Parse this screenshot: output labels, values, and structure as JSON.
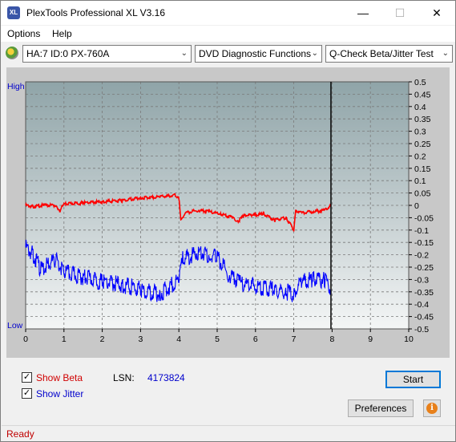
{
  "window": {
    "title": "PlexTools Professional XL V3.16",
    "icon_text": "XL",
    "minimize_glyph": "—",
    "maximize_glyph": "☐",
    "close_glyph": "✕"
  },
  "menu": {
    "options_label": "Options",
    "help_label": "Help"
  },
  "toolbar": {
    "drive": "HA:7 ID:0  PX-760A",
    "function": "DVD Diagnostic Functions",
    "test": "Q-Check Beta/Jitter Test",
    "dropdown_glyph": "⌄"
  },
  "chart_data": {
    "type": "line",
    "left_axis_labels": {
      "top": "High",
      "bottom": "Low"
    },
    "x_ticks": [
      0,
      1,
      2,
      3,
      4,
      5,
      6,
      7,
      8,
      9,
      10
    ],
    "xlim": [
      0,
      10
    ],
    "y_right_ticks": [
      "0.5",
      "0.45",
      "0.4",
      "0.35",
      "0.3",
      "0.25",
      "0.2",
      "0.15",
      "0.1",
      "0.05",
      "0",
      "-0.05",
      "-0.1",
      "-0.15",
      "-0.2",
      "-0.25",
      "-0.3",
      "-0.35",
      "-0.4",
      "-0.45",
      "-0.5"
    ],
    "ylim": [
      -0.5,
      0.5
    ],
    "grid": true,
    "cursor_x": 7.97,
    "series": [
      {
        "color": "#ff0000",
        "x": [
          0,
          0.2,
          0.5,
          0.8,
          0.9,
          0.95,
          1.0,
          1.5,
          2.0,
          2.5,
          3.0,
          3.5,
          3.9,
          4.0,
          4.05,
          4.2,
          4.5,
          4.8,
          5.1,
          5.4,
          5.55,
          5.7,
          5.9,
          6.2,
          6.5,
          6.8,
          7.0,
          7.05,
          7.2,
          7.5,
          7.8,
          7.97
        ],
        "y": [
          0.0,
          -0.005,
          0.0,
          0.0,
          -0.03,
          0.0,
          0.005,
          0.01,
          0.015,
          0.02,
          0.03,
          0.035,
          0.04,
          0.03,
          -0.055,
          -0.03,
          -0.02,
          -0.025,
          -0.035,
          -0.05,
          -0.065,
          -0.04,
          -0.04,
          -0.035,
          -0.06,
          -0.05,
          -0.1,
          -0.02,
          -0.03,
          -0.025,
          -0.02,
          0.0
        ]
      },
      {
        "color": "#0000ff",
        "x": [
          0,
          0.2,
          0.4,
          0.6,
          0.8,
          1.0,
          1.5,
          2.0,
          2.5,
          3.0,
          3.5,
          4.0,
          4.1,
          4.5,
          4.8,
          5.0,
          5.3,
          5.6,
          6.0,
          6.5,
          6.8,
          7.0,
          7.2,
          7.5,
          7.8,
          7.97
        ],
        "y": [
          -0.17,
          -0.2,
          -0.26,
          -0.24,
          -0.22,
          -0.27,
          -0.29,
          -0.31,
          -0.32,
          -0.34,
          -0.36,
          -0.3,
          -0.22,
          -0.19,
          -0.2,
          -0.21,
          -0.28,
          -0.31,
          -0.33,
          -0.34,
          -0.35,
          -0.36,
          -0.31,
          -0.3,
          -0.3,
          -0.34
        ]
      }
    ]
  },
  "options": {
    "show_beta": {
      "label": "Show Beta",
      "checked": true,
      "color": "#d00000"
    },
    "show_jitter": {
      "label": "Show Jitter",
      "checked": true,
      "color": "#0000cc"
    },
    "check_glyph": "✓"
  },
  "lsn": {
    "label": "LSN:",
    "value": "4173824"
  },
  "buttons": {
    "start": "Start",
    "preferences": "Preferences",
    "info_glyph": "i"
  },
  "status": {
    "text": "Ready"
  }
}
